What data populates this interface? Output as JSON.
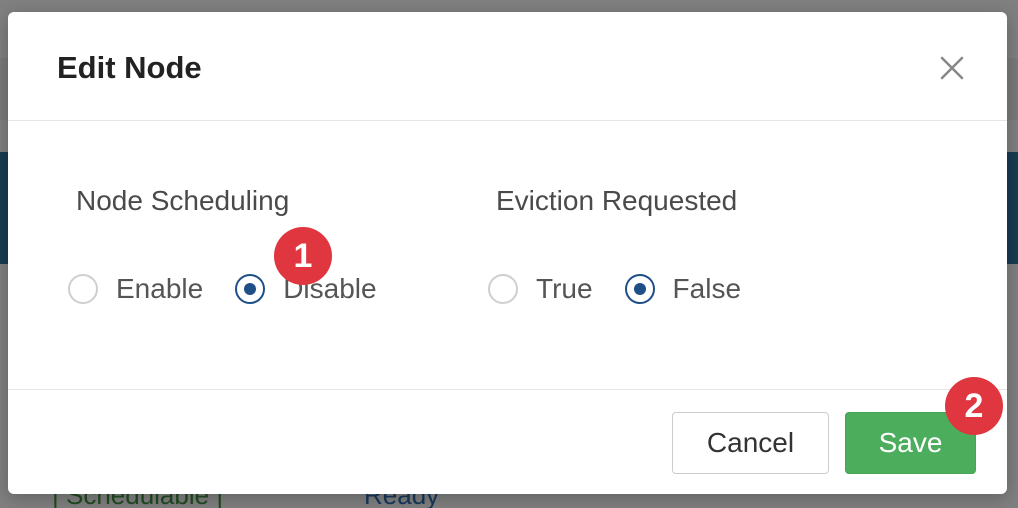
{
  "background": {
    "cell_left": "| Schedulable |",
    "cell_right": "Ready"
  },
  "modal": {
    "title": "Edit Node",
    "close_label": "X",
    "groups": [
      {
        "label": "Node Scheduling",
        "options": [
          {
            "label": "Enable",
            "checked": false
          },
          {
            "label": "Disable",
            "checked": true
          }
        ]
      },
      {
        "label": "Eviction Requested",
        "options": [
          {
            "label": "True",
            "checked": false
          },
          {
            "label": "False",
            "checked": true
          }
        ]
      }
    ],
    "cancel_label": "Cancel",
    "save_label": "Save"
  },
  "annotations": {
    "step1": "1",
    "step2": "2"
  },
  "colors": {
    "accent_radio": "#1f4f86",
    "save_button": "#4cae5c",
    "badge": "#e0363f"
  }
}
